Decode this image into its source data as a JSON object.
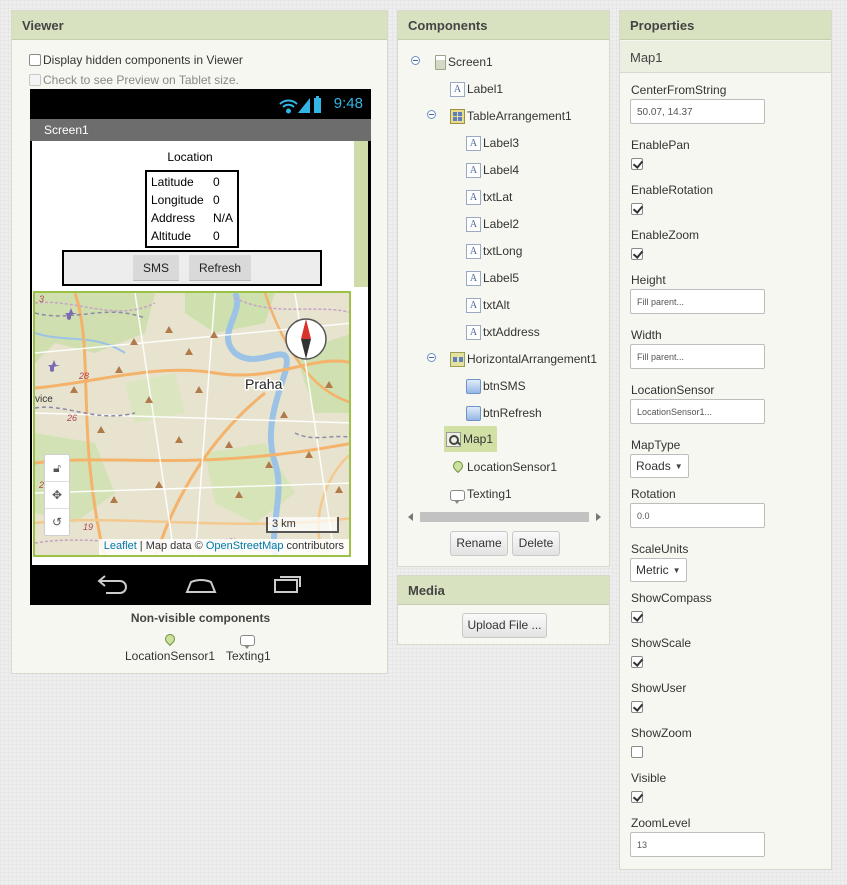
{
  "viewer": {
    "title": "Viewer",
    "display_hidden_label": "Display hidden components in Viewer",
    "tablet_preview_label": "Check to see Preview on Tablet size.",
    "phone": {
      "clock": "9:48",
      "screen_title": "Screen1",
      "location_title": "Location",
      "info": [
        {
          "key": "Latitude",
          "value": "0"
        },
        {
          "key": "Longitude",
          "value": "0"
        },
        {
          "key": "Address",
          "value": "N/A"
        },
        {
          "key": "Altitude",
          "value": "0"
        }
      ],
      "sms_button": "SMS",
      "refresh_button": "Refresh",
      "map": {
        "city_label": "Praha",
        "road_labels": [
          "3",
          "28",
          "26",
          "2",
          "19"
        ],
        "place_fragment": "vice",
        "scale_label": "3 km",
        "attribution_leaflet": "Leaflet",
        "attribution_mapdata": " | Map data © ",
        "attribution_osm": "OpenStreetMap",
        "attribution_tail": " contributors",
        "controls": [
          "lock-icon",
          "move-icon",
          "reset-icon"
        ]
      }
    },
    "nonvisible_title": "Non-visible components",
    "nonvisible": [
      {
        "label": "LocationSensor1",
        "icon": "location-pin-icon"
      },
      {
        "label": "Texting1",
        "icon": "speech-bubble-icon"
      }
    ]
  },
  "components": {
    "title": "Components",
    "tree": {
      "screen1": "Screen1",
      "label1": "Label1",
      "table": "TableArrangement1",
      "label3": "Label3",
      "label4": "Label4",
      "txtLat": "txtLat",
      "label2": "Label2",
      "txtLong": "txtLong",
      "label5": "Label5",
      "txtAlt": "txtAlt",
      "txtAddress": "txtAddress",
      "horiz": "HorizontalArrangement1",
      "btnSMS": "btnSMS",
      "btnRefresh": "btnRefresh",
      "map1": "Map1",
      "locsensor": "LocationSensor1",
      "texting": "Texting1"
    },
    "rename_button": "Rename",
    "delete_button": "Delete"
  },
  "media": {
    "title": "Media",
    "upload_button": "Upload File ..."
  },
  "properties": {
    "title": "Properties",
    "component_name": "Map1",
    "center_label": "CenterFromString",
    "center_value": "50.07, 14.37",
    "enablepan_label": "EnablePan",
    "enablepan": true,
    "enablerotation_label": "EnableRotation",
    "enablerotation": true,
    "enablezoom_label": "EnableZoom",
    "enablezoom": true,
    "height_label": "Height",
    "height_value": "Fill parent...",
    "width_label": "Width",
    "width_value": "Fill parent...",
    "locsensor_label": "LocationSensor",
    "locsensor_value": "LocationSensor1...",
    "maptype_label": "MapType",
    "maptype_value": "Roads",
    "rotation_label": "Rotation",
    "rotation_value": "0.0",
    "scaleunits_label": "ScaleUnits",
    "scaleunits_value": "Metric",
    "showcompass_label": "ShowCompass",
    "showcompass": true,
    "showscale_label": "ShowScale",
    "showscale": true,
    "showuser_label": "ShowUser",
    "showuser": true,
    "showzoom_label": "ShowZoom",
    "showzoom": false,
    "visible_label": "Visible",
    "visible": true,
    "zoomlevel_label": "ZoomLevel",
    "zoomlevel_value": "13"
  },
  "colors": {
    "header_green": "#d8e2c1",
    "selection_green": "#d1e1a6",
    "android_blue": "#33b5e5",
    "map_border": "#9bc147"
  }
}
